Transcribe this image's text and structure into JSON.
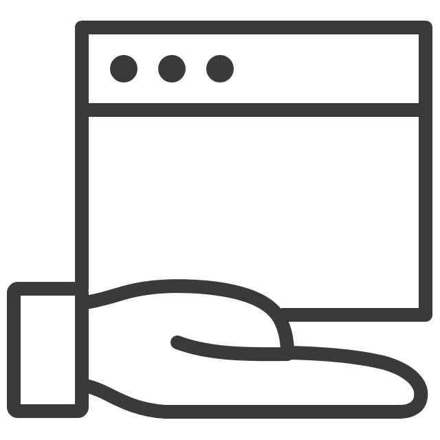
{
  "icon": {
    "name": "web-service-hand-icon",
    "stroke_color": "#3a3a3a",
    "background": "#ffffff",
    "parts": [
      "browser-window-icon",
      "window-dots",
      "hand-icon",
      "sleeve-cuff"
    ]
  }
}
